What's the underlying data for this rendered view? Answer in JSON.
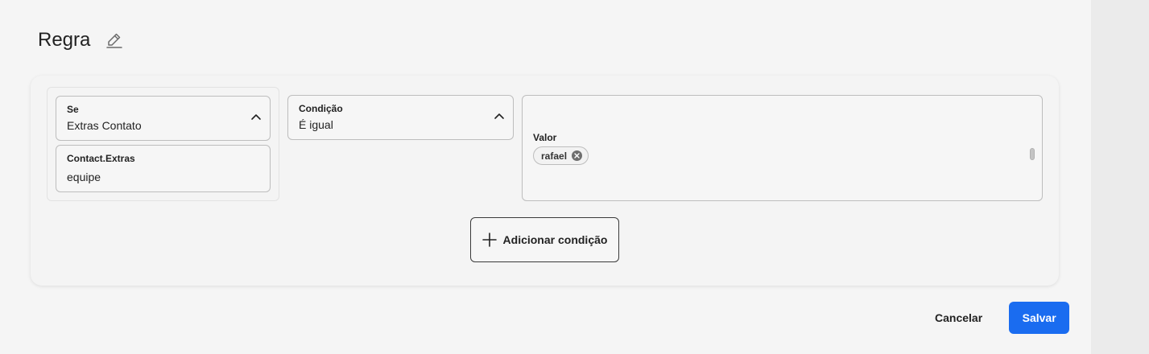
{
  "header": {
    "title": "Regra",
    "edit_icon": "pencil-icon"
  },
  "rule": {
    "se": {
      "label": "Se",
      "value": "Extras Contato"
    },
    "extras": {
      "label": "Contact.Extras",
      "value": "equipe"
    },
    "condicao": {
      "label": "Condição",
      "value": "É igual"
    },
    "valor": {
      "label": "Valor",
      "chips": [
        "rafael"
      ]
    },
    "add_condition_label": "Adicionar condição"
  },
  "footer": {
    "cancel_label": "Cancelar",
    "save_label": "Salvar"
  },
  "colors": {
    "primary": "#1a6cf0",
    "background": "#f5f5f5",
    "rail": "#ebebeb"
  }
}
